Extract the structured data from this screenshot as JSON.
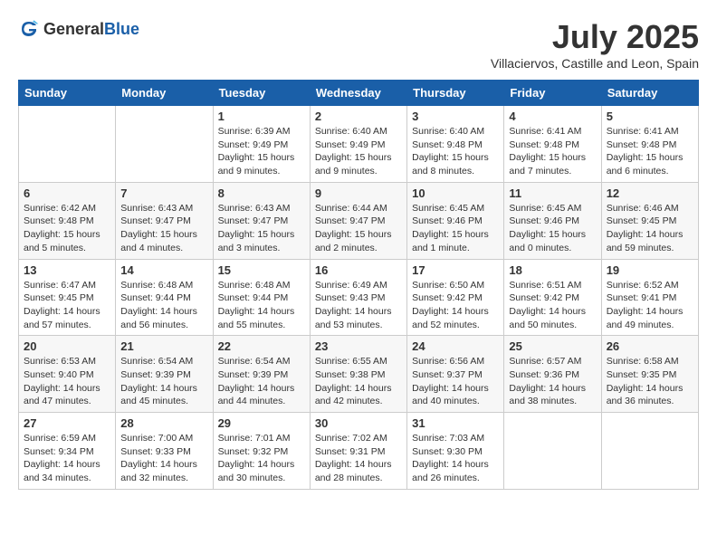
{
  "header": {
    "logo_general": "General",
    "logo_blue": "Blue",
    "month": "July 2025",
    "location": "Villaciervos, Castille and Leon, Spain"
  },
  "weekdays": [
    "Sunday",
    "Monday",
    "Tuesday",
    "Wednesday",
    "Thursday",
    "Friday",
    "Saturday"
  ],
  "weeks": [
    [
      {
        "day": "",
        "sunrise": "",
        "sunset": "",
        "daylight": ""
      },
      {
        "day": "",
        "sunrise": "",
        "sunset": "",
        "daylight": ""
      },
      {
        "day": "1",
        "sunrise": "Sunrise: 6:39 AM",
        "sunset": "Sunset: 9:49 PM",
        "daylight": "Daylight: 15 hours and 9 minutes."
      },
      {
        "day": "2",
        "sunrise": "Sunrise: 6:40 AM",
        "sunset": "Sunset: 9:49 PM",
        "daylight": "Daylight: 15 hours and 9 minutes."
      },
      {
        "day": "3",
        "sunrise": "Sunrise: 6:40 AM",
        "sunset": "Sunset: 9:48 PM",
        "daylight": "Daylight: 15 hours and 8 minutes."
      },
      {
        "day": "4",
        "sunrise": "Sunrise: 6:41 AM",
        "sunset": "Sunset: 9:48 PM",
        "daylight": "Daylight: 15 hours and 7 minutes."
      },
      {
        "day": "5",
        "sunrise": "Sunrise: 6:41 AM",
        "sunset": "Sunset: 9:48 PM",
        "daylight": "Daylight: 15 hours and 6 minutes."
      }
    ],
    [
      {
        "day": "6",
        "sunrise": "Sunrise: 6:42 AM",
        "sunset": "Sunset: 9:48 PM",
        "daylight": "Daylight: 15 hours and 5 minutes."
      },
      {
        "day": "7",
        "sunrise": "Sunrise: 6:43 AM",
        "sunset": "Sunset: 9:47 PM",
        "daylight": "Daylight: 15 hours and 4 minutes."
      },
      {
        "day": "8",
        "sunrise": "Sunrise: 6:43 AM",
        "sunset": "Sunset: 9:47 PM",
        "daylight": "Daylight: 15 hours and 3 minutes."
      },
      {
        "day": "9",
        "sunrise": "Sunrise: 6:44 AM",
        "sunset": "Sunset: 9:47 PM",
        "daylight": "Daylight: 15 hours and 2 minutes."
      },
      {
        "day": "10",
        "sunrise": "Sunrise: 6:45 AM",
        "sunset": "Sunset: 9:46 PM",
        "daylight": "Daylight: 15 hours and 1 minute."
      },
      {
        "day": "11",
        "sunrise": "Sunrise: 6:45 AM",
        "sunset": "Sunset: 9:46 PM",
        "daylight": "Daylight: 15 hours and 0 minutes."
      },
      {
        "day": "12",
        "sunrise": "Sunrise: 6:46 AM",
        "sunset": "Sunset: 9:45 PM",
        "daylight": "Daylight: 14 hours and 59 minutes."
      }
    ],
    [
      {
        "day": "13",
        "sunrise": "Sunrise: 6:47 AM",
        "sunset": "Sunset: 9:45 PM",
        "daylight": "Daylight: 14 hours and 57 minutes."
      },
      {
        "day": "14",
        "sunrise": "Sunrise: 6:48 AM",
        "sunset": "Sunset: 9:44 PM",
        "daylight": "Daylight: 14 hours and 56 minutes."
      },
      {
        "day": "15",
        "sunrise": "Sunrise: 6:48 AM",
        "sunset": "Sunset: 9:44 PM",
        "daylight": "Daylight: 14 hours and 55 minutes."
      },
      {
        "day": "16",
        "sunrise": "Sunrise: 6:49 AM",
        "sunset": "Sunset: 9:43 PM",
        "daylight": "Daylight: 14 hours and 53 minutes."
      },
      {
        "day": "17",
        "sunrise": "Sunrise: 6:50 AM",
        "sunset": "Sunset: 9:42 PM",
        "daylight": "Daylight: 14 hours and 52 minutes."
      },
      {
        "day": "18",
        "sunrise": "Sunrise: 6:51 AM",
        "sunset": "Sunset: 9:42 PM",
        "daylight": "Daylight: 14 hours and 50 minutes."
      },
      {
        "day": "19",
        "sunrise": "Sunrise: 6:52 AM",
        "sunset": "Sunset: 9:41 PM",
        "daylight": "Daylight: 14 hours and 49 minutes."
      }
    ],
    [
      {
        "day": "20",
        "sunrise": "Sunrise: 6:53 AM",
        "sunset": "Sunset: 9:40 PM",
        "daylight": "Daylight: 14 hours and 47 minutes."
      },
      {
        "day": "21",
        "sunrise": "Sunrise: 6:54 AM",
        "sunset": "Sunset: 9:39 PM",
        "daylight": "Daylight: 14 hours and 45 minutes."
      },
      {
        "day": "22",
        "sunrise": "Sunrise: 6:54 AM",
        "sunset": "Sunset: 9:39 PM",
        "daylight": "Daylight: 14 hours and 44 minutes."
      },
      {
        "day": "23",
        "sunrise": "Sunrise: 6:55 AM",
        "sunset": "Sunset: 9:38 PM",
        "daylight": "Daylight: 14 hours and 42 minutes."
      },
      {
        "day": "24",
        "sunrise": "Sunrise: 6:56 AM",
        "sunset": "Sunset: 9:37 PM",
        "daylight": "Daylight: 14 hours and 40 minutes."
      },
      {
        "day": "25",
        "sunrise": "Sunrise: 6:57 AM",
        "sunset": "Sunset: 9:36 PM",
        "daylight": "Daylight: 14 hours and 38 minutes."
      },
      {
        "day": "26",
        "sunrise": "Sunrise: 6:58 AM",
        "sunset": "Sunset: 9:35 PM",
        "daylight": "Daylight: 14 hours and 36 minutes."
      }
    ],
    [
      {
        "day": "27",
        "sunrise": "Sunrise: 6:59 AM",
        "sunset": "Sunset: 9:34 PM",
        "daylight": "Daylight: 14 hours and 34 minutes."
      },
      {
        "day": "28",
        "sunrise": "Sunrise: 7:00 AM",
        "sunset": "Sunset: 9:33 PM",
        "daylight": "Daylight: 14 hours and 32 minutes."
      },
      {
        "day": "29",
        "sunrise": "Sunrise: 7:01 AM",
        "sunset": "Sunset: 9:32 PM",
        "daylight": "Daylight: 14 hours and 30 minutes."
      },
      {
        "day": "30",
        "sunrise": "Sunrise: 7:02 AM",
        "sunset": "Sunset: 9:31 PM",
        "daylight": "Daylight: 14 hours and 28 minutes."
      },
      {
        "day": "31",
        "sunrise": "Sunrise: 7:03 AM",
        "sunset": "Sunset: 9:30 PM",
        "daylight": "Daylight: 14 hours and 26 minutes."
      },
      {
        "day": "",
        "sunrise": "",
        "sunset": "",
        "daylight": ""
      },
      {
        "day": "",
        "sunrise": "",
        "sunset": "",
        "daylight": ""
      }
    ]
  ]
}
